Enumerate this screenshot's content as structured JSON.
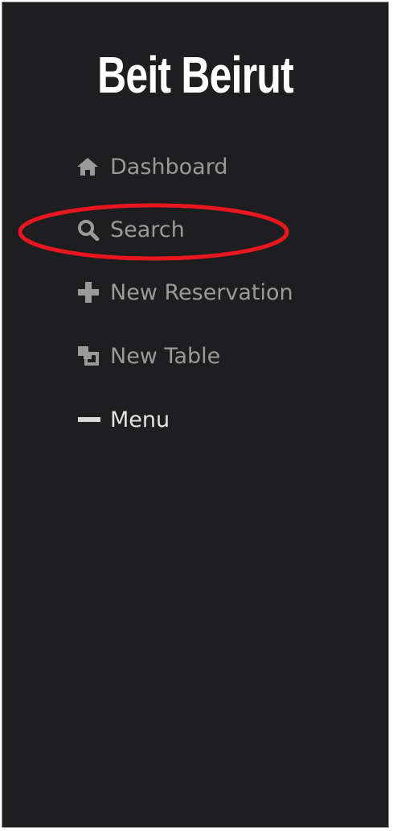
{
  "brand": {
    "title": "Beit Beirut"
  },
  "nav": {
    "items": [
      {
        "label": "Dashboard",
        "icon": "home-icon"
      },
      {
        "label": "Search",
        "icon": "search-icon"
      },
      {
        "label": "New Reservation",
        "icon": "plus-icon"
      },
      {
        "label": "New Table",
        "icon": "copy-icon"
      },
      {
        "label": "Menu",
        "icon": "minus-icon"
      }
    ]
  },
  "colors": {
    "sidebar_bg": "#1e1e20",
    "nav_text": "#9a9a9a",
    "nav_text_active": "#e4e4e4",
    "highlight_ring": "#e8171f"
  }
}
